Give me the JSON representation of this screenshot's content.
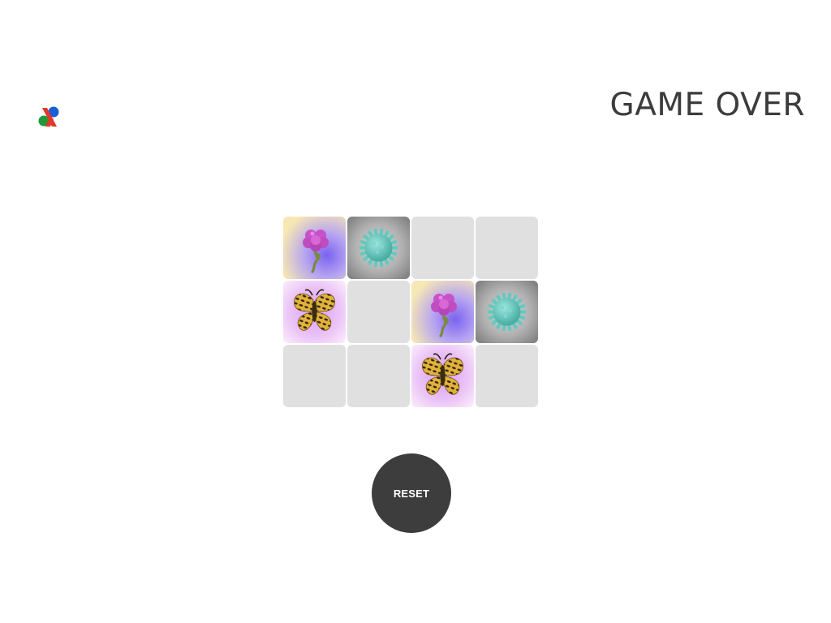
{
  "header": {
    "logo": "game-logo-icon",
    "status_text": "GAME OVER"
  },
  "board": {
    "columns": 4,
    "rows": 3,
    "tiles": [
      {
        "state": "revealed",
        "icon": "flower"
      },
      {
        "state": "revealed",
        "icon": "virus"
      },
      {
        "state": "hidden",
        "icon": ""
      },
      {
        "state": "hidden",
        "icon": ""
      },
      {
        "state": "revealed",
        "icon": "butterfly"
      },
      {
        "state": "hidden",
        "icon": ""
      },
      {
        "state": "revealed",
        "icon": "flower"
      },
      {
        "state": "revealed",
        "icon": "virus"
      },
      {
        "state": "hidden",
        "icon": ""
      },
      {
        "state": "hidden",
        "icon": ""
      },
      {
        "state": "revealed",
        "icon": "butterfly"
      },
      {
        "state": "hidden",
        "icon": ""
      }
    ]
  },
  "controls": {
    "reset_label": "RESET"
  },
  "colors": {
    "hidden_tile": "#e0e0e0",
    "button": "#3d3d3d",
    "status_text": "#3c3c3c"
  }
}
